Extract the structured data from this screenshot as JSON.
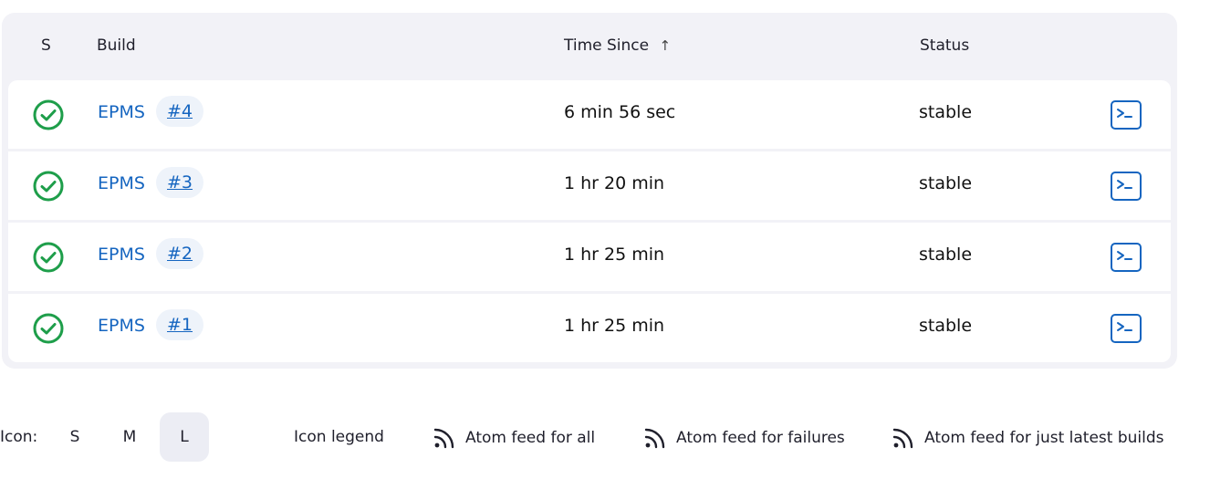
{
  "table": {
    "headers": {
      "s": "S",
      "build": "Build",
      "time_since": "Time Since",
      "sort_arrow": "↑",
      "status": "Status"
    },
    "rows": [
      {
        "job": "EPMS",
        "number": "#4",
        "time": "6 min 56 sec",
        "status": "stable"
      },
      {
        "job": "EPMS",
        "number": "#3",
        "time": "1 hr 20 min",
        "status": "stable"
      },
      {
        "job": "EPMS",
        "number": "#2",
        "time": "1 hr 25 min",
        "status": "stable"
      },
      {
        "job": "EPMS",
        "number": "#1",
        "time": "1 hr 25 min",
        "status": "stable"
      }
    ],
    "status_icon": "check-circle-icon",
    "status_color": "#1e9e4a",
    "console_icon": "terminal-icon",
    "link_color": "#1565c0"
  },
  "footer": {
    "icon_label": "Icon:",
    "sizes": [
      "S",
      "M",
      "L"
    ],
    "active_size": "L",
    "icon_legend": "Icon legend",
    "feed_all": "Atom feed for all",
    "feed_failures": "Atom feed for failures",
    "feed_latest": "Atom feed for just latest builds",
    "feed_icon": "rss-icon"
  }
}
